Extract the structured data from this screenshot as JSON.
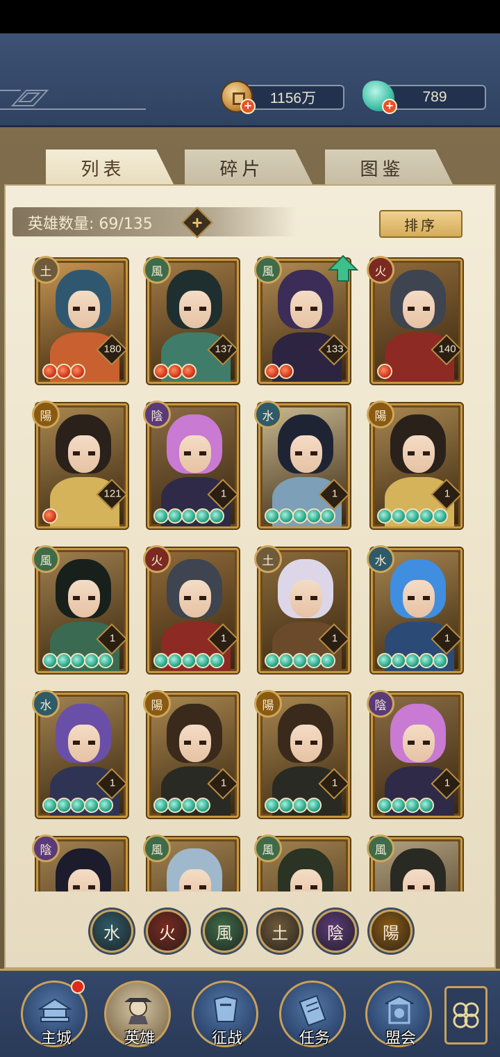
{
  "currency": {
    "coins": "1156万",
    "jade": "789"
  },
  "tabs": [
    {
      "label": "列表",
      "active": true
    },
    {
      "label": "碎片",
      "active": false
    },
    {
      "label": "图鉴",
      "active": false
    }
  ],
  "hero_count": {
    "label": "英雄数量: 69/135"
  },
  "sort_button": {
    "label": "排序"
  },
  "element_colors": {
    "土": "#6f5a3a",
    "風": "#3f6b48",
    "火": "#7a2a20",
    "陽": "#8b5a12",
    "陰": "#5a3a78",
    "水": "#2f5a68"
  },
  "heroes": [
    {
      "element": "土",
      "level": "180",
      "stars": 3,
      "star_color": "red",
      "hair": "#2f5870",
      "body": "#c8612f",
      "bg": "#c69552",
      "up": false
    },
    {
      "element": "風",
      "level": "137",
      "stars": 3,
      "star_color": "red",
      "hair": "#1f2f2f",
      "body": "#3f7d6a",
      "bg": "#a17a46",
      "up": false
    },
    {
      "element": "風",
      "level": "133",
      "stars": 2,
      "star_color": "red",
      "hair": "#3b2d58",
      "body": "#2c2440",
      "bg": "#b08a52",
      "up": true
    },
    {
      "element": "火",
      "level": "140",
      "stars": 1,
      "star_color": "red",
      "hair": "#3e4450",
      "body": "#8d2a24",
      "bg": "#8f6a3a",
      "up": false
    },
    {
      "element": "陽",
      "level": "121",
      "stars": 1,
      "star_color": "red",
      "hair": "#2a211a",
      "body": "#d4b35a",
      "bg": "#a88650",
      "up": false
    },
    {
      "element": "陰",
      "level": "1",
      "stars": 5,
      "star_color": "green",
      "hair": "#c97ad3",
      "body": "#2e2a48",
      "bg": "#8a6c44",
      "up": false
    },
    {
      "element": "水",
      "level": "1",
      "stars": 5,
      "star_color": "green",
      "hair": "#1f2434",
      "body": "#7d9fb8",
      "bg": "#c7b891",
      "up": false
    },
    {
      "element": "陽",
      "level": "1",
      "stars": 5,
      "star_color": "green",
      "hair": "#2a211a",
      "body": "#d4b35a",
      "bg": "#a88650",
      "up": false
    },
    {
      "element": "風",
      "level": "1",
      "stars": 5,
      "star_color": "green",
      "hair": "#18201c",
      "body": "#3b6a52",
      "bg": "#9f7f4e",
      "up": false
    },
    {
      "element": "火",
      "level": "1",
      "stars": 5,
      "star_color": "green",
      "hair": "#3e4450",
      "body": "#8d2a24",
      "bg": "#8f6a3a",
      "up": false
    },
    {
      "element": "土",
      "level": "1",
      "stars": 5,
      "star_color": "green",
      "hair": "#dcd6e8",
      "body": "#6a4a2a",
      "bg": "#8a6a3c",
      "up": false
    },
    {
      "element": "水",
      "level": "1",
      "stars": 5,
      "star_color": "green",
      "hair": "#3f8ee0",
      "body": "#2b4a76",
      "bg": "#a5844f",
      "up": false
    },
    {
      "element": "水",
      "level": "1",
      "stars": 5,
      "star_color": "green",
      "hair": "#6a4fa8",
      "body": "#2f3454",
      "bg": "#a08150",
      "up": false
    },
    {
      "element": "陽",
      "level": "1",
      "stars": 4,
      "star_color": "green",
      "hair": "#3a2a1c",
      "body": "#2a2a24",
      "bg": "#a88650",
      "up": false
    },
    {
      "element": "陽",
      "level": "1",
      "stars": 4,
      "star_color": "green",
      "hair": "#3a2a1c",
      "body": "#2a2a24",
      "bg": "#a88650",
      "up": false
    },
    {
      "element": "陰",
      "level": "1",
      "stars": 4,
      "star_color": "green",
      "hair": "#c97ad3",
      "body": "#2e2a48",
      "bg": "#8a6c44",
      "up": false
    },
    {
      "element": "陰",
      "level": "",
      "stars": 0,
      "star_color": "green",
      "hair": "#1c1c2c",
      "body": "#3a2f4a",
      "bg": "#a08150",
      "up": false
    },
    {
      "element": "風",
      "level": "",
      "stars": 0,
      "star_color": "green",
      "hair": "#9fb8cc",
      "body": "#4a5a6a",
      "bg": "#a08150",
      "up": false
    },
    {
      "element": "風",
      "level": "",
      "stars": 0,
      "star_color": "green",
      "hair": "#2a3324",
      "body": "#4a5a3a",
      "bg": "#a08150",
      "up": false
    },
    {
      "element": "風",
      "level": "",
      "stars": 0,
      "star_color": "green",
      "hair": "#2a2a24",
      "body": "#4a4a3a",
      "bg": "#b0a080",
      "up": false
    }
  ],
  "filters": [
    {
      "label": "水",
      "color": "#2f5a68"
    },
    {
      "label": "火",
      "color": "#7a2a20"
    },
    {
      "label": "風",
      "color": "#3f6b48"
    },
    {
      "label": "土",
      "color": "#6f5a3a"
    },
    {
      "label": "陰",
      "color": "#5a3a78"
    },
    {
      "label": "陽",
      "color": "#8b5a12"
    }
  ],
  "nav": [
    {
      "label": "主城",
      "icon": "palace-icon",
      "active": false
    },
    {
      "label": "英雄",
      "icon": "hero-icon",
      "active": true
    },
    {
      "label": "征战",
      "icon": "campaign-icon",
      "active": false
    },
    {
      "label": "任务",
      "icon": "scroll-icon",
      "active": false
    },
    {
      "label": "盟会",
      "icon": "alliance-icon",
      "active": false
    }
  ],
  "menu_icon": "flower-menu-icon"
}
